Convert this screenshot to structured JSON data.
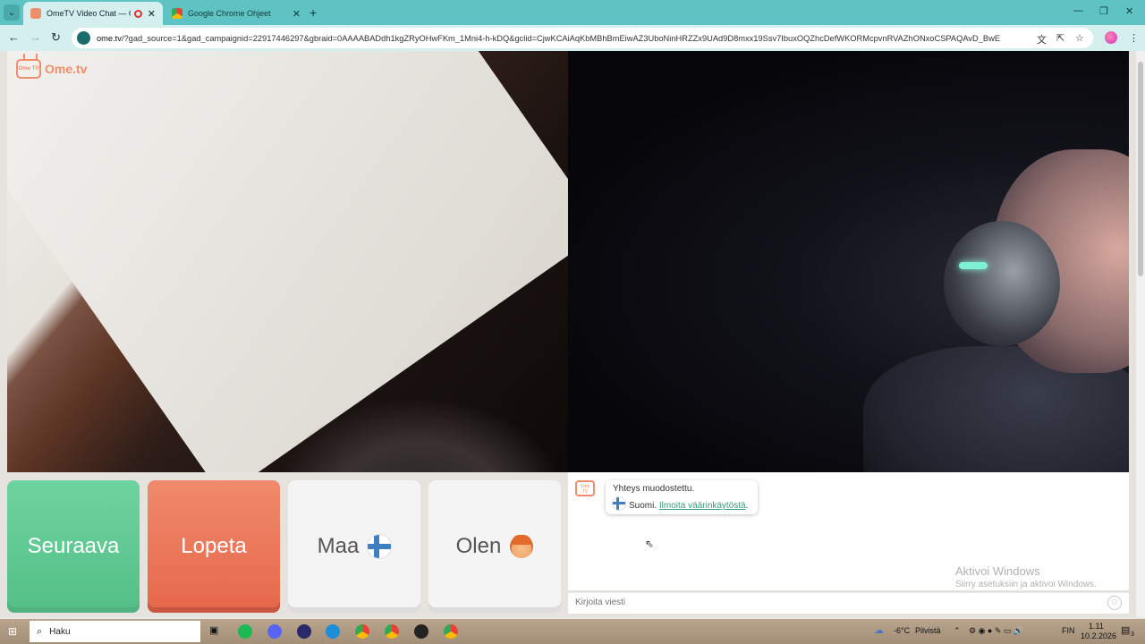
{
  "browser": {
    "tabs": [
      {
        "title": "OmeTV Video Chat — Ome",
        "active": true
      },
      {
        "title": "Google Chrome Ohjeet",
        "active": false
      }
    ],
    "new_tab": "+",
    "url_domain": "ome.tv",
    "url_rest": "/?gad_source=1&gad_campaignid=22917446297&gbraid=0AAAABADdh1kgZRyOHwFKm_1Mni4-h-kDQ&gclid=CjwKCAiAqKbMBhBmEiwAZ3UboNinHRZZx9UAd9D8mxx19Ssv7IbuxOQZhcDefWKORMcpvnRVAZhONxoCSPAQAvD_BwE"
  },
  "page": {
    "logo_text": "Ome.tv",
    "logo_badge": "Ome TV",
    "buttons": {
      "next": "Seuraava",
      "stop": "Lopeta",
      "country": "Maa",
      "gender": "Olen"
    },
    "chat": {
      "system_message": "Yhteys muodostettu.",
      "country_text": "Suomi.",
      "report_link": "Ilmoita väärinkäytöstä",
      "report_suffix": ".",
      "input_placeholder": "Kirjoita viesti"
    },
    "watermark": {
      "title": "Aktivoi Windows",
      "subtitle": "Siirry asetuksiin ja aktivoi Windows."
    }
  },
  "taskbar": {
    "search_label": "Haku",
    "weather_temp": "-6°C",
    "weather_text": "Pilvistä",
    "language": "FIN",
    "time": "1.11",
    "date": "10.2.2026",
    "notification_count": "3"
  },
  "colors": {
    "tabstrip": "#5fc3c3",
    "next_button": "#5fcb93",
    "stop_button": "#eb7558",
    "brand": "#f08d6b"
  }
}
